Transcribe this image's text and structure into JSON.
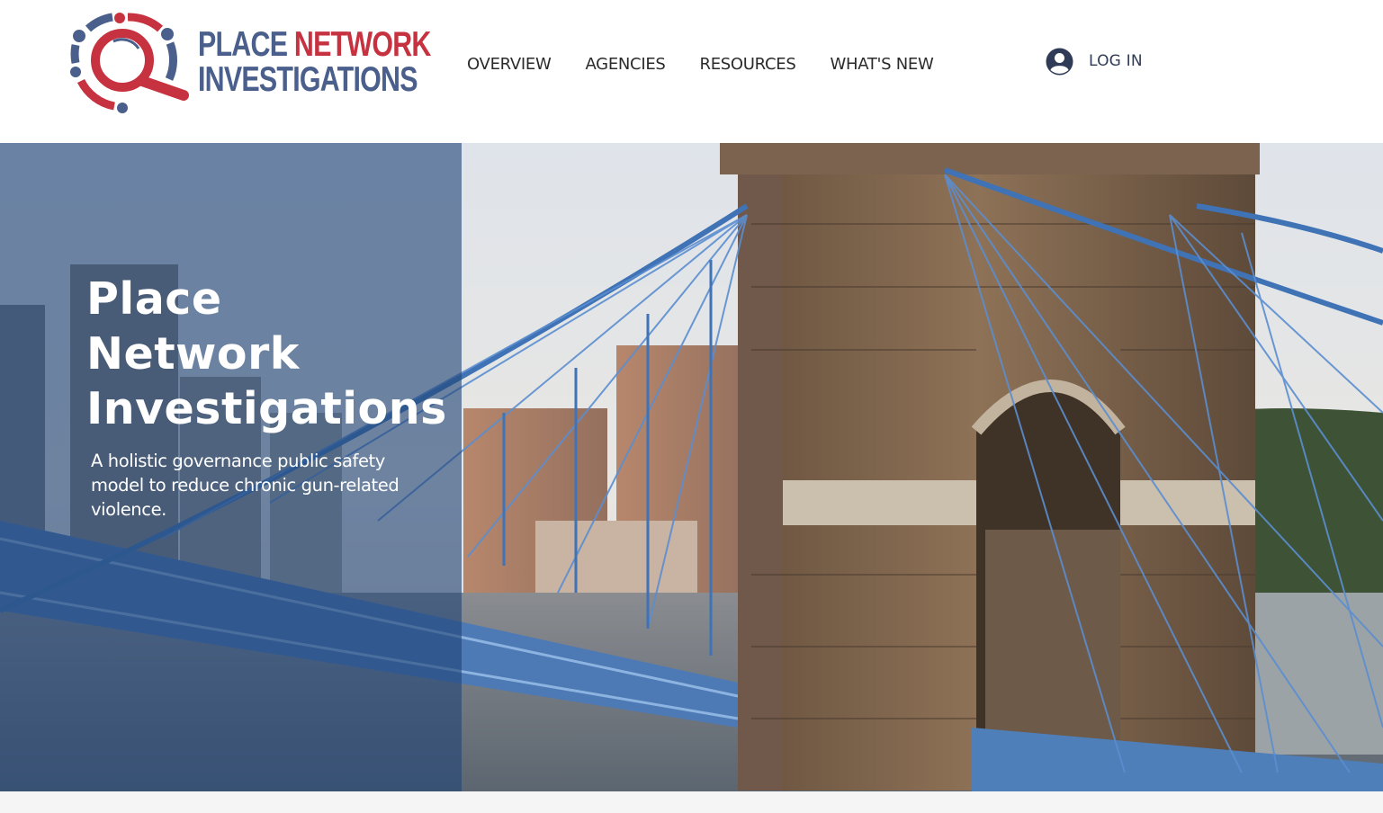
{
  "brand": {
    "line1_part1": "PLACE",
    "line1_part2": "NETWORK",
    "line2": "INVESTIGATIONS",
    "colors": {
      "blue": "#4a5f8c",
      "red": "#c6323f"
    },
    "icon": "magnifier-network-logo"
  },
  "nav": {
    "items": [
      {
        "label": "OVERVIEW"
      },
      {
        "label": "AGENCIES"
      },
      {
        "label": "RESOURCES"
      },
      {
        "label": "WHAT'S NEW"
      }
    ]
  },
  "login": {
    "label": "LOG IN",
    "icon": "user-avatar-icon"
  },
  "hero": {
    "title_lines": [
      "Place",
      "Network",
      "Investigations"
    ],
    "subtitle": "A holistic governance public safety model to reduce chronic gun-related violence.",
    "image": "suspension-bridge-tower-photo",
    "overlay_color": "#224678"
  }
}
